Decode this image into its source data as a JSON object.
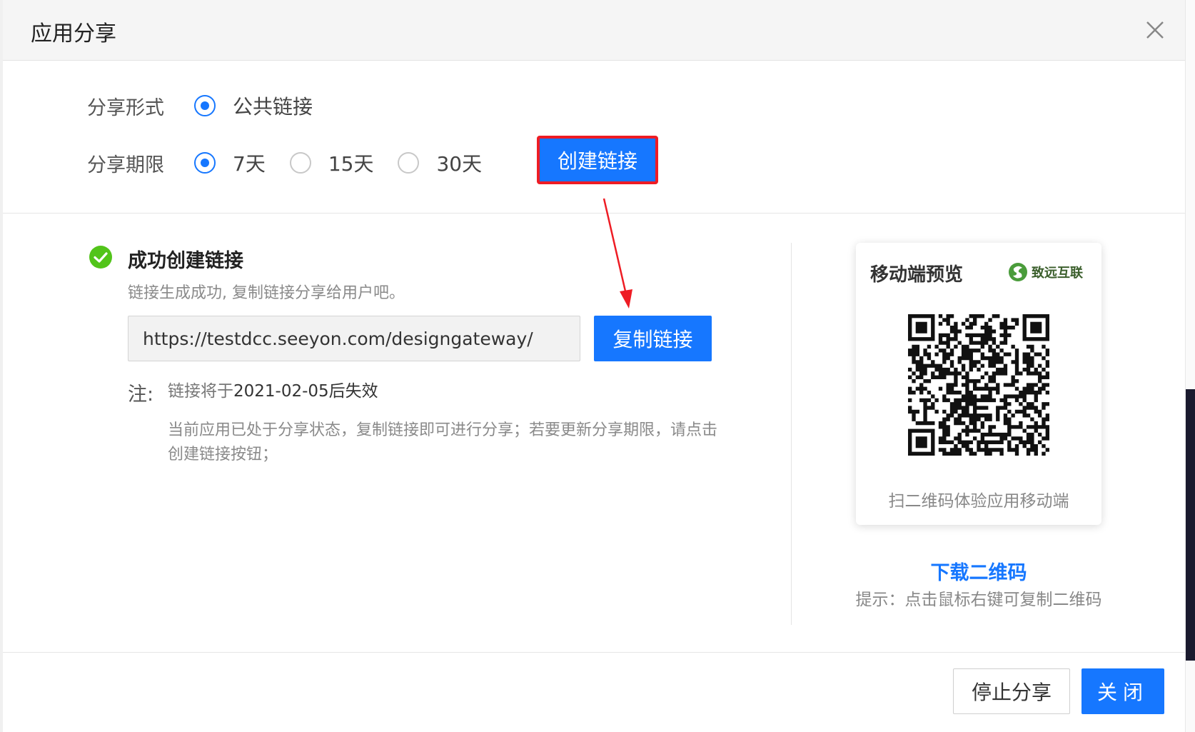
{
  "dialog": {
    "title": "应用分享"
  },
  "share_form": {
    "label": "分享形式",
    "options": [
      {
        "label": "公共链接",
        "selected": true
      }
    ]
  },
  "share_period": {
    "label": "分享期限",
    "options": [
      {
        "label": "7天",
        "selected": true
      },
      {
        "label": "15天",
        "selected": false
      },
      {
        "label": "30天",
        "selected": false
      }
    ],
    "create_button": "创建链接"
  },
  "result": {
    "title": "成功创建链接",
    "description": "链接生成成功, 复制链接分享给用户吧。",
    "url": "https://testdcc.seeyon.com/designgateway/",
    "copy_button": "复制链接",
    "note_label": "注:",
    "expire_prefix": "链接将于",
    "expire_date": "2021-02-05后失效",
    "note_body": "当前应用已处于分享状态，复制链接即可进行分享；若要更新分享期限，请点击创建链接按钮；"
  },
  "preview": {
    "title": "移动端预览",
    "brand": "致远互联",
    "caption": "扫二维码体验应用移动端",
    "download_link": "下载二维码",
    "hint": "提示：点击鼠标右键可复制二维码"
  },
  "footer": {
    "stop_button": "停止分享",
    "close_button": "关闭"
  },
  "colors": {
    "primary": "#1677ff",
    "highlight": "#ee1c24",
    "success": "#52c41a"
  }
}
